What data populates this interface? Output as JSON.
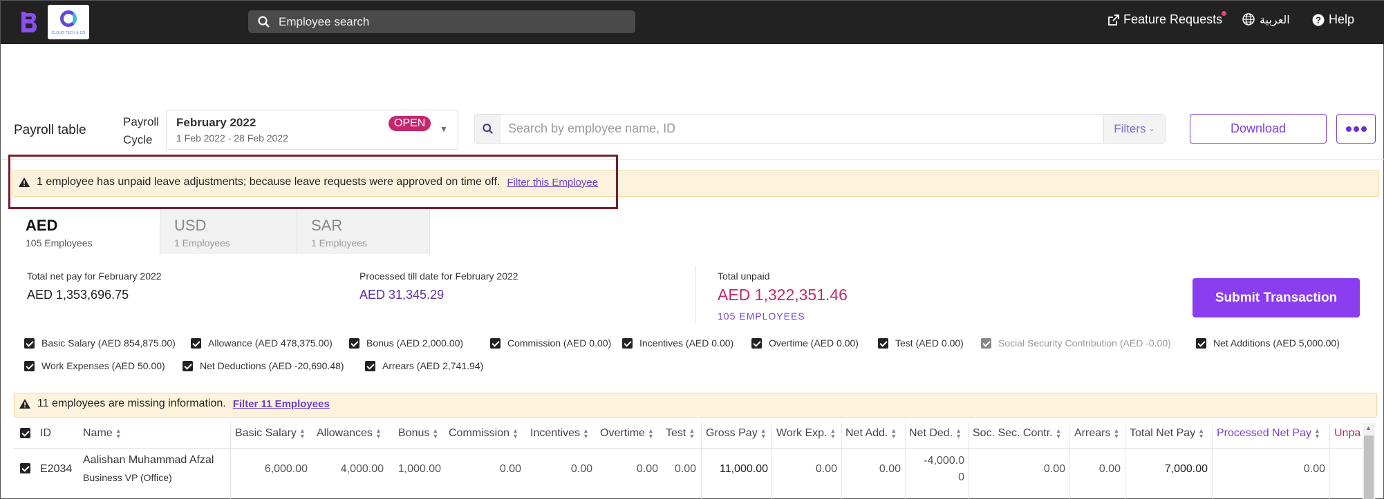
{
  "topbar": {
    "search_placeholder": "Employee search",
    "company_logo_text": "CLOUD TECH & CO",
    "feature_requests": "Feature Requests",
    "language": "العربية",
    "help": "Help"
  },
  "header": {
    "title": "Payroll table",
    "cycle_label_1": "Payroll",
    "cycle_label_2": "Cycle",
    "cycle_name": "February 2022",
    "cycle_range": "1 Feb 2022 - 28 Feb 2022",
    "cycle_status": "OPEN",
    "search_placeholder": "Search by employee name, ID",
    "filters": "Filters",
    "download": "Download"
  },
  "warning": {
    "text": "1 employee has unpaid leave adjustments; because leave requests were approved on time off.",
    "link": "Filter this Employee"
  },
  "tabs": [
    {
      "code": "AED",
      "count": "105 Employees",
      "active": true
    },
    {
      "code": "USD",
      "count": "1 Employees",
      "active": false
    },
    {
      "code": "SAR",
      "count": "1 Employees",
      "active": false
    }
  ],
  "totals": {
    "net_pay_label": "Total net pay for February 2022",
    "net_pay_value": "AED 1,353,696.75",
    "processed_label": "Processed till date for February 2022",
    "processed_value": "AED 31,345.29",
    "unpaid_label": "Total unpaid",
    "unpaid_value": "AED 1,322,351.46",
    "unpaid_employees": "105 EMPLOYEES",
    "submit": "Submit Transaction"
  },
  "components_row1": [
    {
      "label": "Basic Salary (AED 854,875.00)",
      "dim": false
    },
    {
      "label": "Allowance (AED 478,375.00)",
      "dim": false
    },
    {
      "label": "Bonus (AED 2,000.00)",
      "dim": false
    },
    {
      "label": "Commission (AED 0.00)",
      "dim": false
    },
    {
      "label": "Incentives (AED 0.00)",
      "dim": false
    },
    {
      "label": "Overtime (AED 0.00)",
      "dim": false
    },
    {
      "label": "Test (AED 0.00)",
      "dim": false
    },
    {
      "label": "Social Security Contribution (AED -0.00)",
      "dim": true
    },
    {
      "label": "Net Additions (AED 5,000.00)",
      "dim": false
    }
  ],
  "components_row2": [
    {
      "label": "Work Expenses (AED 50.00)",
      "dim": false
    },
    {
      "label": "Net Deductions (AED -20,690.48)",
      "dim": false
    },
    {
      "label": "Arrears (AED 2,741.94)",
      "dim": false
    }
  ],
  "missing": {
    "text": "11 employees are missing information.",
    "link": "Filter 11 Employees"
  },
  "table": {
    "columns": [
      "ID",
      "Name",
      "Basic Salary",
      "Allowances",
      "Bonus",
      "Commission",
      "Incentives",
      "Overtime",
      "Test",
      "Gross Pay",
      "Work Exp.",
      "Net Add.",
      "Net Ded.",
      "Soc. Sec. Contr.",
      "Arrears",
      "Total Net Pay",
      "Processed Net Pay",
      "Unpa"
    ],
    "rows": [
      {
        "id": "E2034",
        "name": "Aalishan Muhammad Afzal",
        "title": "Business VP (Office)",
        "basic_salary": "6,000.00",
        "allowances": "4,000.00",
        "bonus": "1,000.00",
        "commission": "0.00",
        "incentives": "0.00",
        "overtime": "0.00",
        "test": "0.00",
        "gross_pay": "11,000.00",
        "work_exp": "0.00",
        "net_add": "0.00",
        "net_ded_1": "-4,000.0",
        "net_ded_2": "0",
        "soc_sec": "0.00",
        "arrears": "0.00",
        "total_net_pay": "7,000.00",
        "processed_net_pay": "0.00"
      }
    ]
  }
}
